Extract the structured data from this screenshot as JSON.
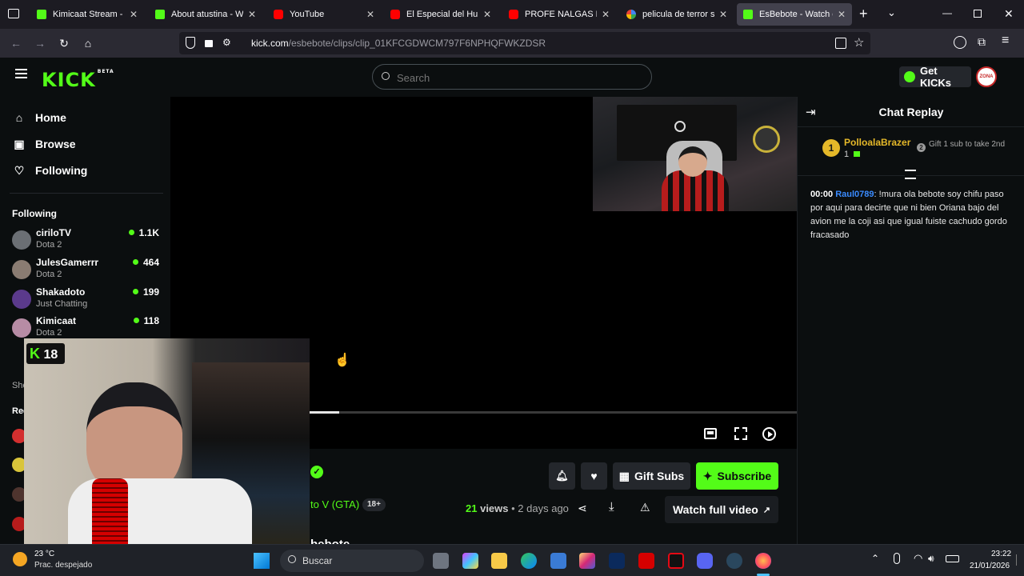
{
  "tabs": [
    {
      "title": "Kimicaat Stream - Watc",
      "favicon": "kick",
      "active": false
    },
    {
      "title": "About atustina - Watch",
      "favicon": "kick",
      "active": false
    },
    {
      "title": "YouTube",
      "favicon": "youtube",
      "active": false
    },
    {
      "title": "El Especial del Humor",
      "favicon": "youtube",
      "active": false
    },
    {
      "title": "PROFE NALGAS LE PR",
      "favicon": "youtube",
      "active": false
    },
    {
      "title": "pelicula de terror sonri",
      "favicon": "google",
      "active": false
    },
    {
      "title": "EsBebote - Watch clips",
      "favicon": "kick",
      "active": true
    }
  ],
  "url": {
    "domain": "kick.com",
    "path": "/esbebote/clips/clip_01KFCGDWCM797F6NPHQFWKZDSR"
  },
  "header": {
    "logo": "KICK",
    "logo_badge": "BETA",
    "search_placeholder": "Search",
    "get_kicks": "Get KICKs",
    "avatar_text": "ZONA"
  },
  "sidebar": {
    "nav": [
      {
        "label": "Home",
        "icon": "home-icon"
      },
      {
        "label": "Browse",
        "icon": "browse-icon"
      },
      {
        "label": "Following",
        "icon": "heart-icon"
      }
    ],
    "following_heading": "Following",
    "channels": [
      {
        "name": "ciriloTV",
        "category": "Dota 2",
        "viewers": "1.1K"
      },
      {
        "name": "JulesGamerrr",
        "category": "Dota 2",
        "viewers": "464"
      },
      {
        "name": "Shakadoto",
        "category": "Just Chatting",
        "viewers": "199"
      },
      {
        "name": "Kimicaat",
        "category": "Dota 2",
        "viewers": "118"
      }
    ],
    "partial_labels": [
      "Sho",
      "Rec"
    ]
  },
  "player": {
    "progress_fraction": 0.27,
    "overlay_badge": "18"
  },
  "info": {
    "category_partial": "to V (GTA)",
    "age_badge": "18+",
    "views_count": "21",
    "views_label": "views",
    "time_ago": "2 days ago",
    "name_partial": "bebote"
  },
  "actions": {
    "gift_subs": "Gift Subs",
    "subscribe": "Subscribe",
    "watch_full": "Watch full video"
  },
  "chat": {
    "title": "Chat Replay",
    "top_gifter": {
      "name": "PolloalaBrazer",
      "rank": "1",
      "count": "1"
    },
    "second": {
      "rank": "2",
      "text": "Gift 1 sub to take 2nd"
    },
    "messages": [
      {
        "time": "00:00",
        "user": "Raul0789",
        "text": "!mura ola bebote soy chifu paso por aqui para decirte que ni bien Oriana bajo del avion me la coji asi que igual fuiste cachudo gordo fracasado"
      }
    ]
  },
  "taskbar": {
    "weather_temp": "23 °C",
    "weather_desc": "Prac. despejado",
    "search_label": "Buscar",
    "time": "23:22",
    "date": "21/01/2026"
  },
  "colors": {
    "accent": "#53fc18",
    "bg": "#0b0e0f",
    "username": "#3a8bff",
    "gold": "#e5b829"
  }
}
